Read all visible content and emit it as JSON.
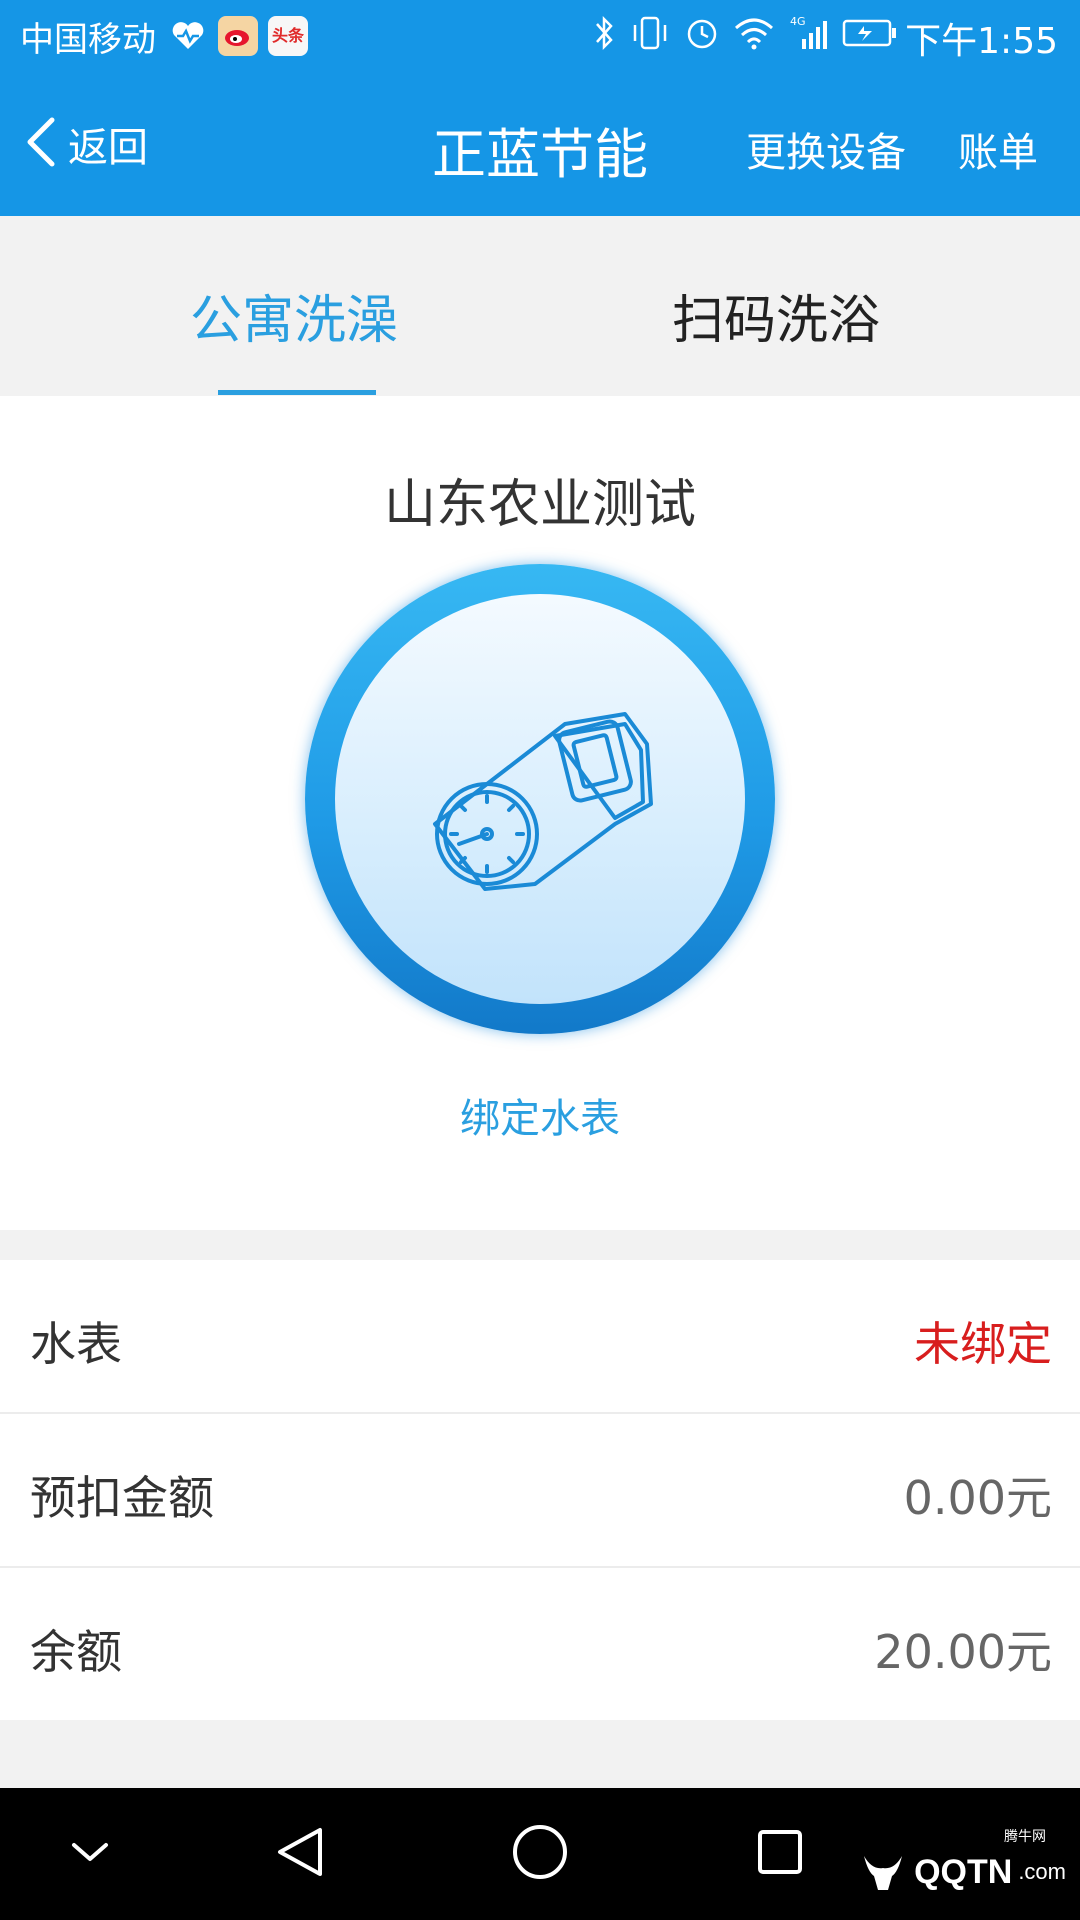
{
  "status_bar": {
    "carrier": "中国移动",
    "toutiao_label": "头条",
    "time": "下午1:55",
    "network": "4G"
  },
  "navbar": {
    "back_label": "返回",
    "title": "正蓝节能",
    "change_device": "更换设备",
    "bill": "账单"
  },
  "tabs": {
    "items": [
      {
        "label": "公寓洗澡",
        "active": true
      },
      {
        "label": "扫码洗浴",
        "active": false
      }
    ]
  },
  "device": {
    "name": "山东农业测试",
    "bind_label": "绑定水表"
  },
  "info": {
    "rows": [
      {
        "label": "水表",
        "value": "未绑定"
      },
      {
        "label": "预扣金额",
        "value": "0.00元"
      },
      {
        "label": "余额",
        "value": "20.00元"
      }
    ]
  },
  "watermark": {
    "brand": "QQTN",
    "suffix": ".com",
    "small": "腾牛网"
  },
  "colors": {
    "primary": "#1596e6",
    "accent": "#2a9fe0",
    "warning": "#d81e1e"
  }
}
